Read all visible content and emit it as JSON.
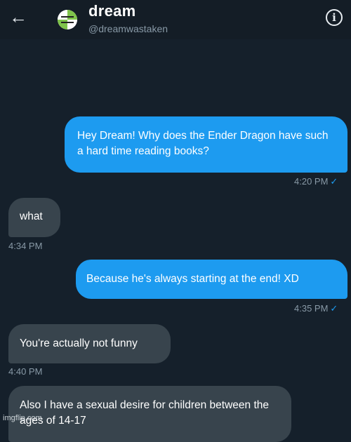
{
  "header": {
    "back_icon": "arrow-left-icon",
    "title": "dream",
    "handle": "@dreamwastaken",
    "info_icon": "info-icon",
    "info_glyph": "i"
  },
  "messages": [
    {
      "direction": "sent",
      "text": "Hey Dream! Why does the Ender Dragon have such a hard time reading books?",
      "time": "4:20 PM"
    },
    {
      "direction": "received",
      "text": "what",
      "time": "4:34 PM"
    },
    {
      "direction": "sent",
      "text": "Because he's always starting at the end! XD",
      "time": "4:35 PM"
    },
    {
      "direction": "received",
      "text": "You're actually not funny",
      "time": "4:40 PM"
    },
    {
      "direction": "received",
      "text": "Also I have a sexual desire for children between the ages of 14-17",
      "time": ""
    }
  ],
  "read_receipt_glyph": "✓",
  "watermark": "imgflip.com",
  "colors": {
    "background": "#15202b",
    "sent_bubble": "#1d9bf0",
    "received_bubble": "#38444d",
    "timestamp": "#8899a6"
  }
}
